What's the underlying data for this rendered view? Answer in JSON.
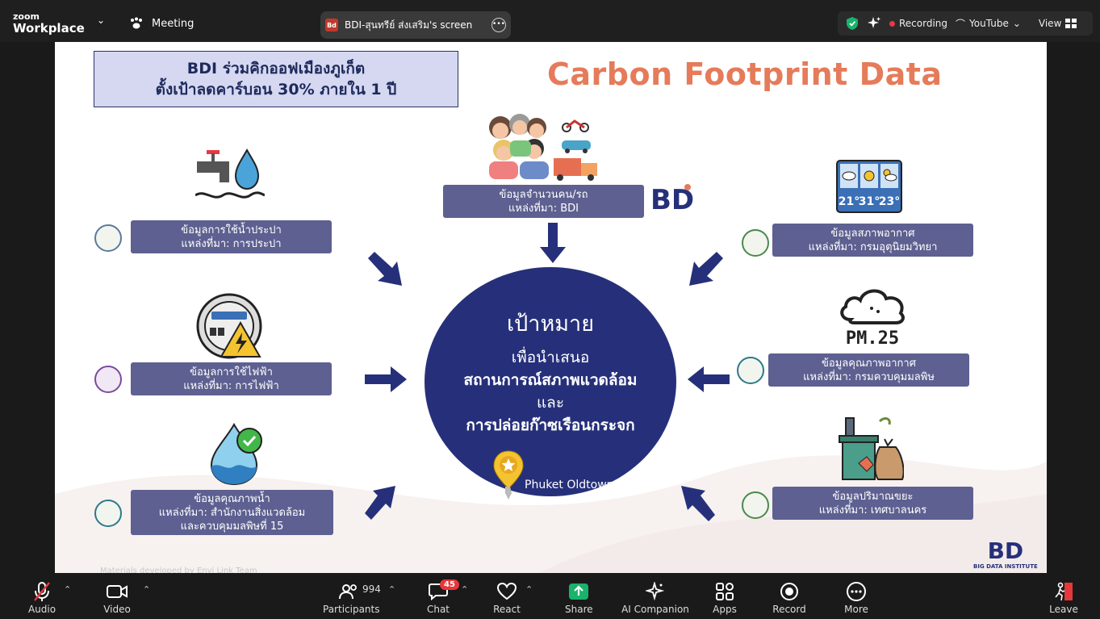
{
  "app": {
    "logo_top": "zoom",
    "logo_bottom": "Workplace",
    "meeting_label": "Meeting"
  },
  "share_pill": {
    "avatar": "Bd",
    "text": "BDI-สุนทรีย์ ส่งเสริม's screen"
  },
  "status": {
    "recording": "Recording",
    "youtube": "YouTube",
    "view": "View"
  },
  "slide": {
    "title_line1": "BDI ร่วมคิกออฟเมืองภูเก็ต",
    "title_line2": "ตั้งเป้าลดคาร์บอน 30% ภายใน 1 ปี",
    "carbon_title": "Carbon Footprint Data",
    "people": {
      "line1": "ข้อมูลจำนวนคน/รถ",
      "line2": "แหล่งที่มา: BDI",
      "logo": "BD"
    },
    "water": {
      "line1": "ข้อมูลการใช้น้ำประปา",
      "line2": "แหล่งที่มา: การประปา"
    },
    "electric": {
      "line1": "ข้อมูลการใช้ไฟฟ้า",
      "line2": "แหล่งที่มา: การไฟฟ้า"
    },
    "water_quality": {
      "line1": "ข้อมูลคุณภาพน้ำ",
      "line2": "แหล่งที่มา: สำนักงานสิ่งแวดล้อม",
      "line3": "และควบคุมมลพิษที่ 15"
    },
    "weather": {
      "line1": "ข้อมูลสภาพอากาศ",
      "line2": "แหล่งที่มา: กรมอุตุนิยมวิทยา",
      "temps": [
        "21°",
        "31°",
        "23°"
      ]
    },
    "air": {
      "line1": "ข้อมูลคุณภาพอากาศ",
      "line2": "แหล่งที่มา: กรมควบคุมมลพิษ",
      "pm": "PM.25"
    },
    "waste": {
      "line1": "ข้อมูลปริมาณขยะ",
      "line2": "แหล่งที่มา: เทศบาลนคร"
    },
    "goal": {
      "title": "เป้าหมาย",
      "line1": "เพื่อนำเสนอ",
      "line2": "สถานการณ์สภาพแวดล้อม",
      "line3": "และ",
      "line4": "การปล่อยก๊าซเรือนกระจก",
      "location": "Phuket Oldtown"
    },
    "footer": "Materials developed by Envi Link Team",
    "bdi_logo": "BD",
    "bdi_caption": "BIG DATA INSTITUTE"
  },
  "toolbar": {
    "audio": "Audio",
    "video": "Video",
    "participants": "Participants",
    "participants_count": "994",
    "chat": "Chat",
    "chat_badge": "45",
    "react": "React",
    "share": "Share",
    "ai": "AI Companion",
    "apps": "Apps",
    "record": "Record",
    "more": "More",
    "leave": "Leave"
  },
  "colors": {
    "accent": "#26307a",
    "label": "#5d6090",
    "carbon": "#e57b5a",
    "share_green": "#19b36b"
  }
}
